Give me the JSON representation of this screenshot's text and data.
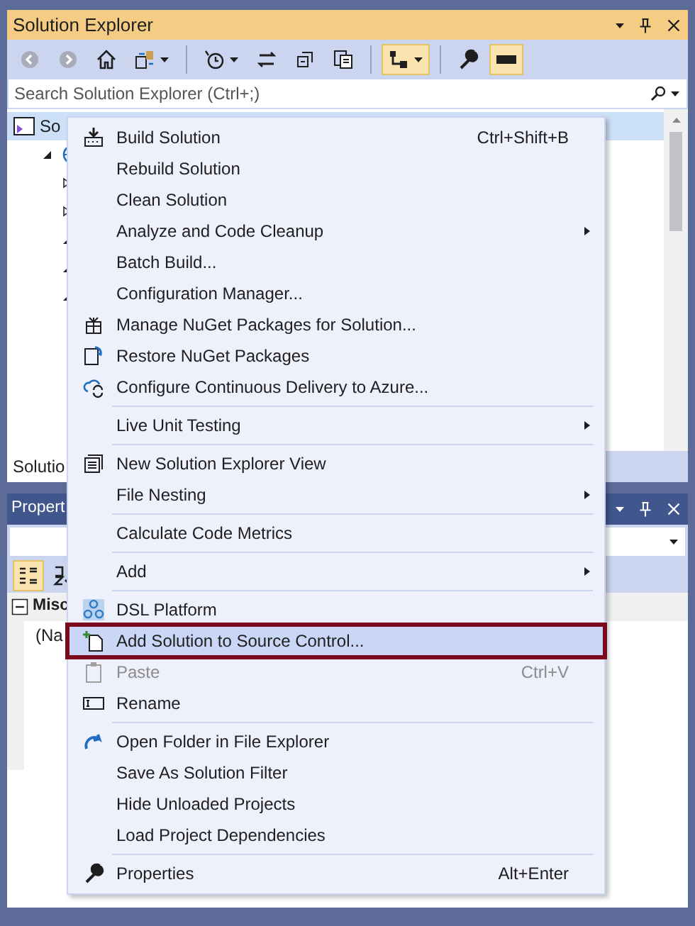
{
  "solution_explorer": {
    "title": "Solution Explorer",
    "toolbar": [
      {
        "kind": "button",
        "on": false
      },
      {
        "kind": "button",
        "on": false
      },
      {
        "kind": "button",
        "on": false
      },
      {
        "kind": "dropdown",
        "on": false
      },
      {
        "kind": "separator"
      },
      {
        "kind": "dropdown",
        "on": false
      },
      {
        "kind": "button",
        "on": false
      },
      {
        "kind": "button",
        "on": false
      },
      {
        "kind": "button",
        "on": false
      },
      {
        "kind": "separator"
      },
      {
        "kind": "dropdown",
        "on": true
      },
      {
        "kind": "separator"
      },
      {
        "kind": "button",
        "on": false
      },
      {
        "kind": "button",
        "on": true
      }
    ],
    "search": {
      "placeholder": "Search Solution Explorer (Ctrl+;)"
    },
    "tree": [
      {
        "label": "So",
        "selected": true,
        "children": [
          {
            "selected": false,
            "expanded": true,
            "children": [
              {
                "selected": false,
                "expanded": false
              },
              {
                "selected": false,
                "expanded": false
              },
              {
                "selected": false,
                "expanded": true
              },
              {
                "selected": false,
                "expanded": true
              },
              {
                "selected": false,
                "expanded": true
              }
            ]
          }
        ]
      }
    ],
    "bottom_tab": "Solutio"
  },
  "properties": {
    "title": "Propert",
    "category": "Misc",
    "category_expanded": true,
    "property": "(Na"
  },
  "context_menu": [
    {
      "kind": "item",
      "label": "Build Solution",
      "shortcut": "Ctrl+Shift+B",
      "submenu": false,
      "disabled": false,
      "selected": false
    },
    {
      "kind": "item",
      "label": "Rebuild Solution",
      "submenu": false,
      "disabled": false,
      "selected": false
    },
    {
      "kind": "item",
      "label": "Clean Solution",
      "submenu": false,
      "disabled": false,
      "selected": false
    },
    {
      "kind": "item",
      "label": "Analyze and Code Cleanup",
      "submenu": true,
      "disabled": false,
      "selected": false
    },
    {
      "kind": "item",
      "label": "Batch Build...",
      "submenu": false,
      "disabled": false,
      "selected": false
    },
    {
      "kind": "item",
      "label": "Configuration Manager...",
      "submenu": false,
      "disabled": false,
      "selected": false
    },
    {
      "kind": "item",
      "label": "Manage NuGet Packages for Solution...",
      "submenu": false,
      "disabled": false,
      "selected": false
    },
    {
      "kind": "item",
      "label": "Restore NuGet Packages",
      "submenu": false,
      "disabled": false,
      "selected": false
    },
    {
      "kind": "item",
      "label": "Configure Continuous Delivery to Azure...",
      "submenu": false,
      "disabled": false,
      "selected": false
    },
    {
      "kind": "separator"
    },
    {
      "kind": "item",
      "label": "Live Unit Testing",
      "submenu": true,
      "disabled": false,
      "selected": false
    },
    {
      "kind": "separator"
    },
    {
      "kind": "item",
      "label": "New Solution Explorer View",
      "submenu": false,
      "disabled": false,
      "selected": false
    },
    {
      "kind": "item",
      "label": "File Nesting",
      "submenu": true,
      "disabled": false,
      "selected": false
    },
    {
      "kind": "separator"
    },
    {
      "kind": "item",
      "label": "Calculate Code Metrics",
      "submenu": false,
      "disabled": false,
      "selected": false
    },
    {
      "kind": "separator"
    },
    {
      "kind": "item",
      "label": "Add",
      "submenu": true,
      "disabled": false,
      "selected": false
    },
    {
      "kind": "separator"
    },
    {
      "kind": "item",
      "label": "DSL Platform",
      "submenu": false,
      "disabled": false,
      "selected": false
    },
    {
      "kind": "item",
      "label": "Add Solution to Source Control...",
      "submenu": false,
      "disabled": false,
      "selected": true
    },
    {
      "kind": "item",
      "label": "Paste",
      "shortcut": "Ctrl+V",
      "submenu": false,
      "disabled": true,
      "selected": false
    },
    {
      "kind": "item",
      "label": "Rename",
      "submenu": false,
      "disabled": false,
      "selected": false
    },
    {
      "kind": "separator"
    },
    {
      "kind": "item",
      "label": "Open Folder in File Explorer",
      "submenu": false,
      "disabled": false,
      "selected": false
    },
    {
      "kind": "item",
      "label": "Save As Solution Filter",
      "submenu": false,
      "disabled": false,
      "selected": false
    },
    {
      "kind": "item",
      "label": "Hide Unloaded Projects",
      "submenu": false,
      "disabled": false,
      "selected": false
    },
    {
      "kind": "item",
      "label": "Load Project Dependencies",
      "submenu": false,
      "disabled": false,
      "selected": false
    },
    {
      "kind": "separator"
    },
    {
      "kind": "item",
      "label": "Properties",
      "shortcut": "Alt+Enter",
      "submenu": false,
      "disabled": false,
      "selected": false
    }
  ]
}
